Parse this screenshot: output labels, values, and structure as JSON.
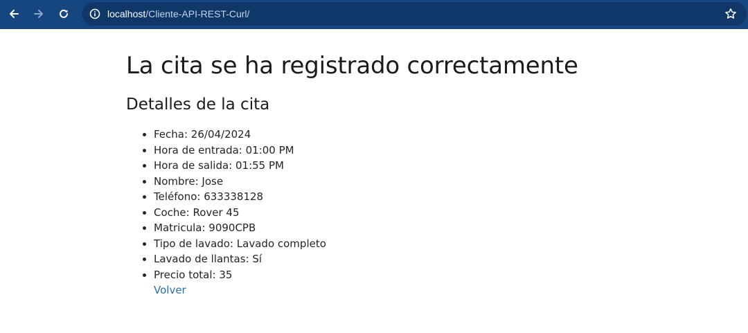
{
  "browser": {
    "url_host": "localhost",
    "url_path": "/Cliente-API-REST-Curl/",
    "toolbar_color": "#15467f"
  },
  "page": {
    "title": "La cita se ha registrado correctamente",
    "subtitle": "Detalles de la cita",
    "details": [
      "Fecha: 26/04/2024",
      "Hora de entrada: 01:00 PM",
      "Hora de salida: 01:55 PM",
      "Nombre: Jose",
      "Teléfono: 633338128",
      "Coche: Rover 45",
      "Matricula: 9090CPB",
      "Tipo de lavado: Lavado completo",
      "Lavado de llantas: Sí",
      "Precio total: 35"
    ],
    "back_link": "Volver",
    "link_color": "#2a6ead"
  }
}
